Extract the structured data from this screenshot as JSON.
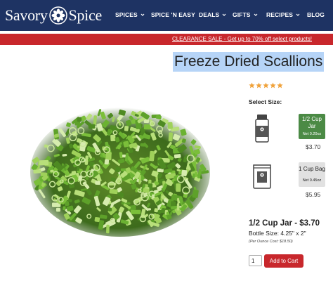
{
  "header": {
    "logo": {
      "left": "Savory",
      "right": "Spice"
    },
    "nav": [
      {
        "label": "SPICES",
        "dropdown": true
      },
      {
        "label": "SPICE 'N EASY",
        "dropdown": false
      },
      {
        "label": "DEALS",
        "dropdown": true
      },
      {
        "label": "GIFTS",
        "dropdown": true
      },
      {
        "label": "RECIPES",
        "dropdown": true
      },
      {
        "label": "BLOG",
        "dropdown": false
      }
    ]
  },
  "sale_bar": {
    "text": "CLEARANCE SALE - Get up to 70% off select products!"
  },
  "product": {
    "title": "Freeze Dried Scallions",
    "rating": 5,
    "select_label": "Select Size:",
    "sizes": [
      {
        "name": "1/2 Cup Jar",
        "net": "Net 0.20oz",
        "price": "$3.70",
        "selected": true,
        "icon": "spice-jar-icon"
      },
      {
        "name": "1 Cup Bag",
        "net": "Net 0.45oz",
        "price": "$5.95",
        "selected": false,
        "icon": "spice-bag-icon"
      }
    ],
    "selected": {
      "title": "1/2 Cup Jar - $3.70",
      "bottle_size": "Bottle Size: 4.25\" x 2\"",
      "per_ounce": "(Per Ounce Cost: $18.50)"
    },
    "quantity": "1",
    "add_to_cart": "Add to Cart"
  },
  "colors": {
    "header_bg": "#1e3363",
    "sale_bg": "#c8272c",
    "selected_size": "#4b8a45",
    "unselected_size": "#e1e1e1",
    "star": "#f0a23a",
    "title_highlight": "#b6d4f7",
    "button": "#c8272c"
  }
}
